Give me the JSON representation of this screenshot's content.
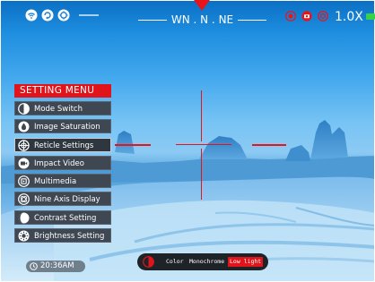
{
  "compass": {
    "heading": "WN . N . NE"
  },
  "zoom": {
    "level": "1.0X"
  },
  "menu": {
    "title": "SETTING MENU",
    "items": [
      {
        "label": "Mode Switch",
        "icon": "mode-switch-icon"
      },
      {
        "label": "Image Saturation",
        "icon": "saturation-icon"
      },
      {
        "label": "Reticle Settings",
        "icon": "reticle-icon",
        "active": true
      },
      {
        "label": "Impact Video",
        "icon": "video-icon"
      },
      {
        "label": "Multimedia",
        "icon": "multimedia-icon"
      },
      {
        "label": "Nine Axis Display",
        "icon": "nine-axis-icon"
      },
      {
        "label": "Contrast Setting",
        "icon": "contrast-icon"
      },
      {
        "label": "Brightness Setting",
        "icon": "brightness-icon"
      }
    ]
  },
  "status": {
    "time": "20:36AM"
  },
  "color_mode": {
    "options": [
      "Color",
      "Monochrome",
      "Low light"
    ],
    "selected": "Low light"
  },
  "colors": {
    "accent": "#e0141b",
    "menu_bg": "#3e4752",
    "battery": "#38d24a"
  }
}
